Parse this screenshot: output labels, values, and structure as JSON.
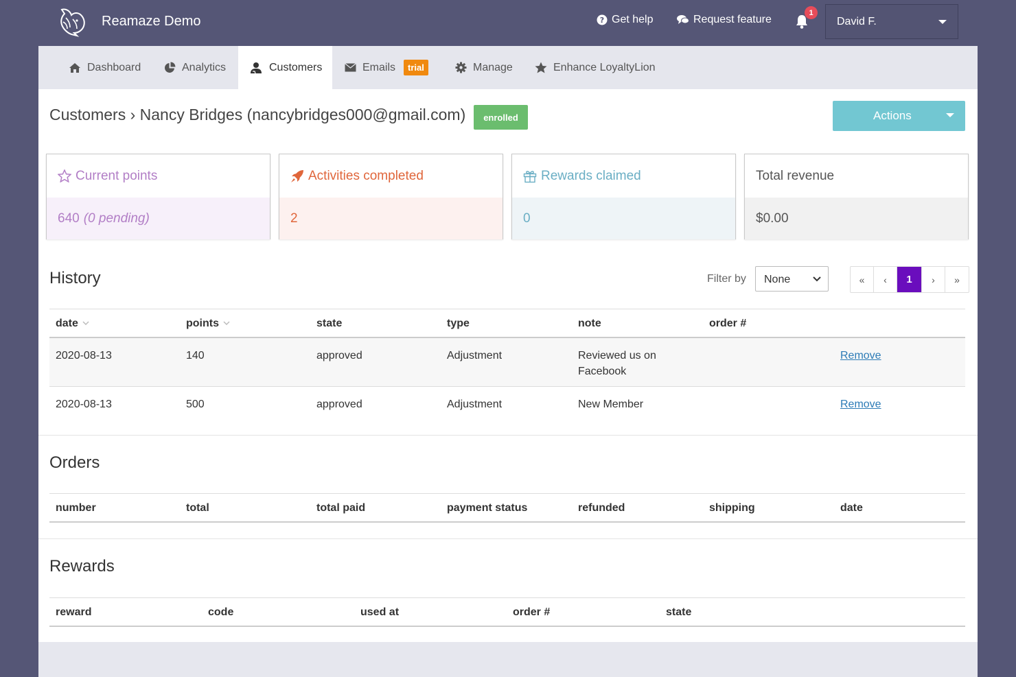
{
  "brand": {
    "name": "Reamaze Demo"
  },
  "topnav": {
    "help_label": "Get help",
    "feature_label": "Request feature",
    "notification_count": "1",
    "user_name": "David F."
  },
  "tabs": [
    {
      "label": "Dashboard",
      "icon": "home-icon"
    },
    {
      "label": "Analytics",
      "icon": "pie-chart-icon"
    },
    {
      "label": "Customers",
      "icon": "user-icon",
      "active": true
    },
    {
      "label": "Emails",
      "icon": "envelope-icon",
      "badge": "trial"
    },
    {
      "label": "Manage",
      "icon": "gear-icon"
    },
    {
      "label": "Enhance LoyaltyLion",
      "icon": "star-icon"
    }
  ],
  "header": {
    "title": "Customers › Nancy Bridges (nancybridges000@gmail.com)",
    "status_badge": "enrolled",
    "actions_label": "Actions"
  },
  "stats": {
    "points": {
      "label": "Current points",
      "value": "640",
      "pending": "(0 pending)"
    },
    "activities": {
      "label": "Activities completed",
      "value": "2"
    },
    "rewards": {
      "label": "Rewards claimed",
      "value": "0"
    },
    "revenue": {
      "label": "Total revenue",
      "value": "$0.00"
    }
  },
  "history": {
    "title": "History",
    "filter_label": "Filter by",
    "filter_value": "None",
    "pager": {
      "first": "«",
      "prev": "‹",
      "current": "1",
      "next": "›",
      "last": "»"
    },
    "columns": [
      "date",
      "points",
      "state",
      "type",
      "note",
      "order #"
    ],
    "rows": [
      {
        "date": "2020-08-13",
        "points": "140",
        "state": "approved",
        "type": "Adjustment",
        "note_line1": "Reviewed us on",
        "note_line2": "Facebook",
        "action": "Remove"
      },
      {
        "date": "2020-08-13",
        "points": "500",
        "state": "approved",
        "type": "Adjustment",
        "note_line1": "New Member",
        "note_line2": "",
        "action": "Remove"
      }
    ]
  },
  "orders": {
    "title": "Orders",
    "columns": [
      "number",
      "total",
      "total paid",
      "payment status",
      "refunded",
      "shipping",
      "date"
    ]
  },
  "rewards": {
    "title": "Rewards",
    "columns": [
      "reward",
      "code",
      "used at",
      "order #",
      "state"
    ]
  },
  "colors": {
    "background": "#555676",
    "actions": "#72c7d2",
    "enrolled": "#6bbd6e",
    "trial": "#f0890f",
    "pager_active": "#6a0dbd"
  }
}
